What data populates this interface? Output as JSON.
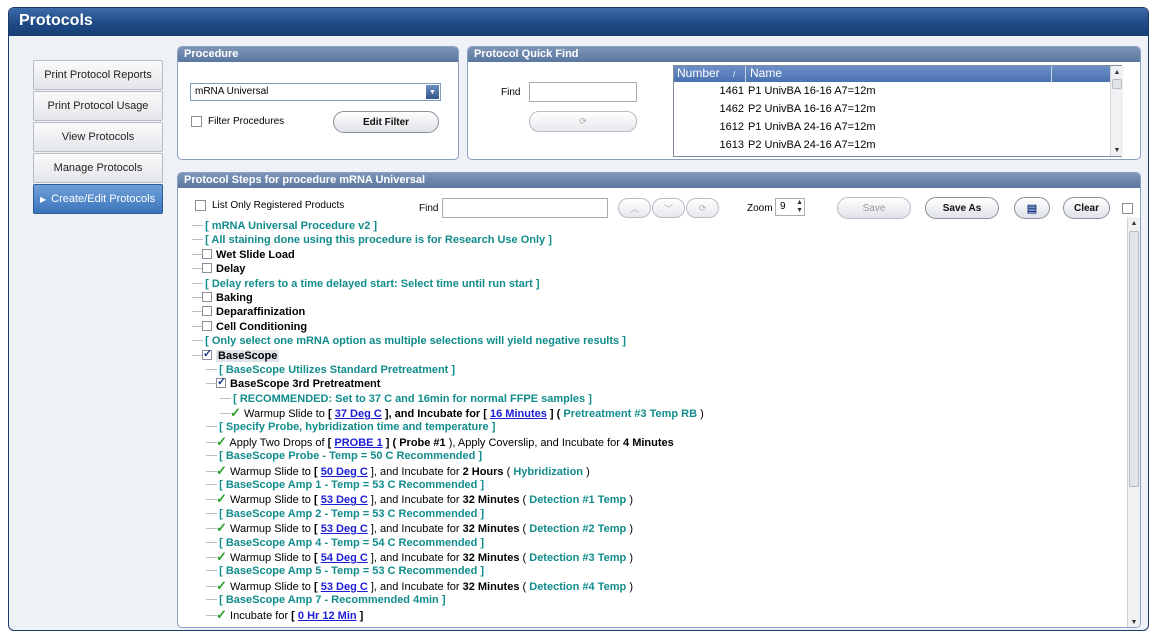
{
  "window": {
    "title": "Protocols"
  },
  "nav": [
    {
      "label": "Print Protocol Reports"
    },
    {
      "label": "Print Protocol Usage"
    },
    {
      "label": "View Protocols"
    },
    {
      "label": "Manage Protocols"
    },
    {
      "label": "Create/Edit Protocols"
    }
  ],
  "procedure": {
    "header": "Procedure",
    "selected": "mRNA Universal",
    "filter_label": "Filter Procedures",
    "edit_filter": "Edit Filter"
  },
  "quickfind": {
    "header": "Protocol Quick Find",
    "find_label": "Find",
    "find_value": "",
    "columns": [
      "Number",
      "Name"
    ],
    "rows": [
      {
        "number": "1461",
        "name": "P1 UnivBA  16-16  A7=12m"
      },
      {
        "number": "1462",
        "name": "P2 UnivBA  16-16  A7=12m"
      },
      {
        "number": "1612",
        "name": "P1 UnivBA  24-16  A7=12m"
      },
      {
        "number": "1613",
        "name": "P2 UnivBA  24-16  A7=12m"
      }
    ]
  },
  "steps": {
    "header": "Protocol Steps for procedure mRNA Universal",
    "list_only_label": "List Only Registered Products",
    "find_label": "Find",
    "find_value": "",
    "zoom_label": "Zoom",
    "zoom_value": "9",
    "save": "Save",
    "save_as": "Save As",
    "clear": "Clear"
  },
  "tree": {
    "l1": "[ mRNA Universal Procedure v2 ]",
    "l2": "[ All staining done using this procedure is for Research Use Only ]",
    "l3": "Wet Slide Load",
    "l4": "Delay",
    "l5": "[ Delay refers to a time delayed start: Select time until run start ]",
    "l6": "Baking",
    "l7": "Deparaffinization",
    "l8": "Cell Conditioning",
    "l9": "[ Only select one mRNA option as multiple selections will yield negative results ]",
    "l10": "BaseScope",
    "l11": "[ BaseScope Utilizes Standard Pretreatment ]",
    "l12": "BaseScope 3rd Pretreatment",
    "l13": "[ RECOMMENDED: Set to 37 C and 16min for normal FFPE samples ]",
    "l14": {
      "a": "Warmup Slide to",
      "b": "[",
      "c": "37 Deg C",
      "d": "], and Incubate for",
      "e": "[",
      "f": "16 Minutes",
      "g": "] (",
      "h": "Pretreatment #3 Temp RB",
      "i": ")"
    },
    "l15": "[ Specify Probe, hybridization time and temperature ]",
    "l16": {
      "a": "Apply Two Drops of",
      "b": "[",
      "c": "PROBE 1",
      "d": "] (",
      "e": "Probe #1",
      "f": "), Apply Coverslip, and Incubate for",
      "g": "4 Minutes"
    },
    "l17": "[ BaseScope Probe - Temp = 50 C Recommended ]",
    "l18": {
      "a": "Warmup Slide to",
      "b": "[",
      "c": "50 Deg C",
      "d": "], and Incubate for",
      "e": "2 Hours",
      "f": "(",
      "g": "Hybridization",
      "h": ")"
    },
    "l19": "[ BaseScope Amp 1 - Temp = 53 C Recommended ]",
    "l20": {
      "a": "Warmup Slide to",
      "b": "[",
      "c": "53 Deg C",
      "d": "], and Incubate for",
      "e": "32 Minutes",
      "f": "(",
      "g": "Detection #1 Temp",
      "h": ")"
    },
    "l21": "[ BaseScope Amp 2 - Temp = 53 C Recommended ]",
    "l22": {
      "a": "Warmup Slide to",
      "b": "[",
      "c": "53 Deg C",
      "d": "], and Incubate for",
      "e": "32 Minutes",
      "f": "(",
      "g": "Detection #2 Temp",
      "h": ")"
    },
    "l23": "[ BaseScope Amp 4 - Temp = 54 C Recommended ]",
    "l24": {
      "a": "Warmup Slide to",
      "b": "[",
      "c": "54 Deg C",
      "d": "], and Incubate for",
      "e": "32 Minutes",
      "f": "(",
      "g": "Detection #3 Temp",
      "h": ")"
    },
    "l25": "[ BaseScope Amp 5 - Temp = 53 C Recommended ]",
    "l26": {
      "a": "Warmup Slide to",
      "b": "[",
      "c": "53 Deg C",
      "d": "], and Incubate for",
      "e": "32 Minutes",
      "f": "(",
      "g": "Detection #4 Temp",
      "h": ")"
    },
    "l27": "[ BaseScope Amp 7 - Recommended 4min ]",
    "l28": {
      "a": "Incubate for",
      "b": "[",
      "c": "0 Hr 12 Min",
      "d": "]"
    }
  }
}
